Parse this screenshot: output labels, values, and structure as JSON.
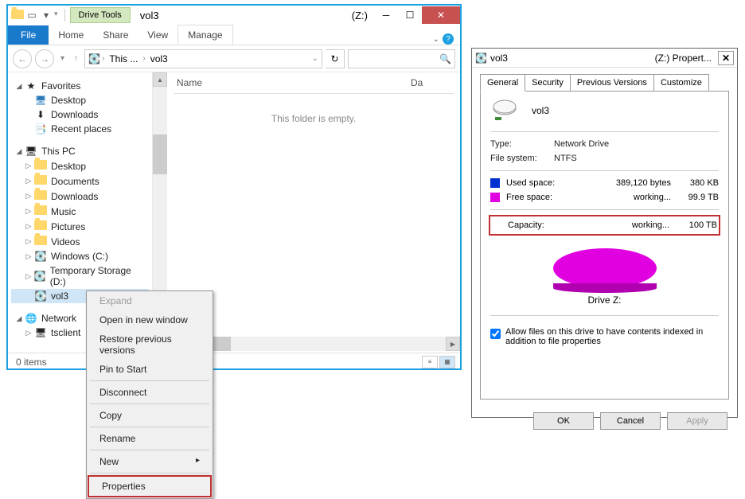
{
  "explorer": {
    "driveToolsTab": "Drive Tools",
    "titleText": "vol3",
    "titleDrive": "(Z:)",
    "ribbon": {
      "file": "File",
      "home": "Home",
      "share": "Share",
      "view": "View",
      "manage": "Manage"
    },
    "breadcrumb": {
      "root": "This ...",
      "folder": "vol3"
    },
    "columns": {
      "name": "Name",
      "date": "Da"
    },
    "emptyMsg": "This folder is empty.",
    "sidebar": {
      "favorites": "Favorites",
      "favItems": [
        "Desktop",
        "Downloads",
        "Recent places"
      ],
      "thisPC": "This PC",
      "pcItems": [
        "Desktop",
        "Documents",
        "Downloads",
        "Music",
        "Pictures",
        "Videos",
        "Windows (C:)",
        "Temporary Storage (D:)",
        "vol3"
      ],
      "network": "Network",
      "netItems": [
        "tsclient"
      ]
    },
    "status": "0 items",
    "hscrollLabel": "III"
  },
  "contextMenu": {
    "items": [
      "Expand",
      "Open in new window",
      "Restore previous versions",
      "Pin to Start",
      "Disconnect",
      "Copy",
      "Rename",
      "New",
      "Properties"
    ]
  },
  "props": {
    "title": "vol3",
    "titleDrive": "(Z:) Propert...",
    "tabs": [
      "General",
      "Security",
      "Previous Versions",
      "Customize"
    ],
    "volName": "vol3",
    "typeLabel": "Type:",
    "typeVal": "Network Drive",
    "fsLabel": "File system:",
    "fsVal": "NTFS",
    "usedLabel": "Used space:",
    "usedBytes": "389,120 bytes",
    "usedHuman": "380 KB",
    "freeLabel": "Free space:",
    "freeBytes": "working...",
    "freeHuman": "99.9 TB",
    "capLabel": "Capacity:",
    "capBytes": "working...",
    "capHuman": "100 TB",
    "driveLetter": "Drive Z:",
    "indexLabel": "Allow files on this drive to have contents indexed in addition to file properties",
    "buttons": {
      "ok": "OK",
      "cancel": "Cancel",
      "apply": "Apply"
    }
  },
  "colors": {
    "used": "#0030d0",
    "free": "#e000e0"
  }
}
